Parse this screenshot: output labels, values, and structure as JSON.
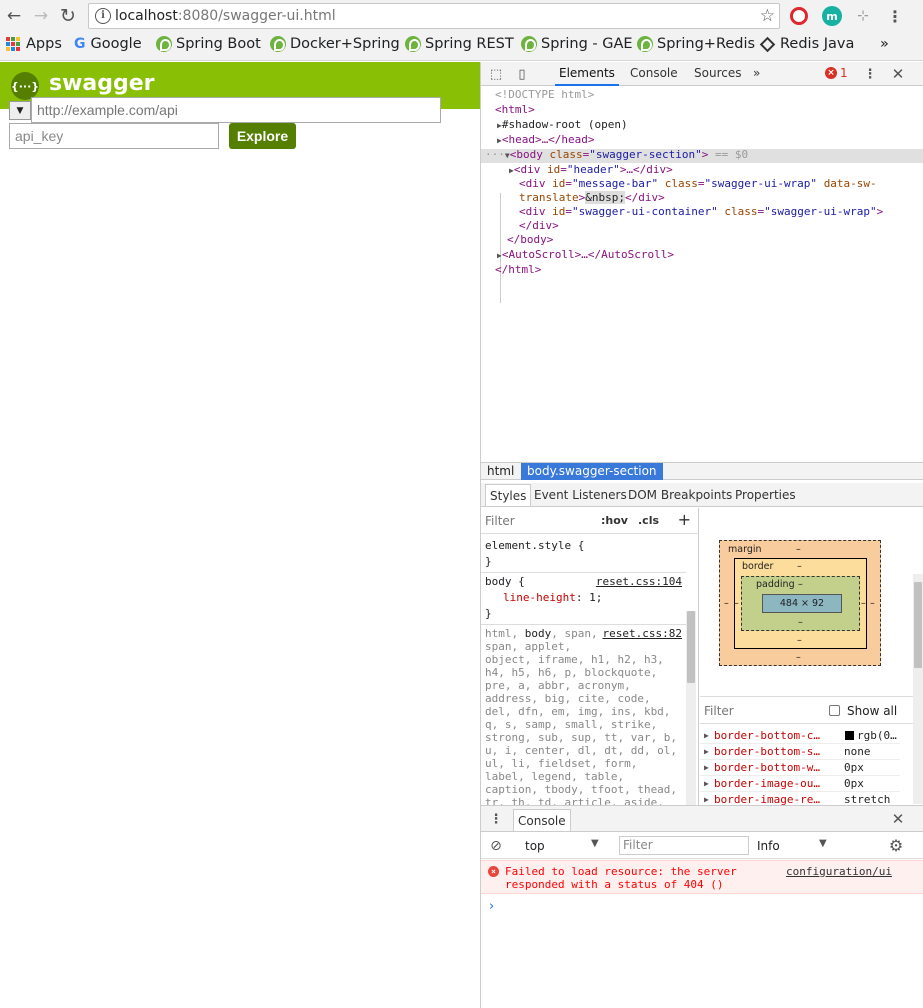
{
  "browser": {
    "url_host": "localhost",
    "url_rest": ":8080/swagger-ui.html",
    "bookmarks": [
      {
        "label": "Apps"
      },
      {
        "label": "Google"
      },
      {
        "label": "Spring Boot"
      },
      {
        "label": "Docker+Spring"
      },
      {
        "label": "Spring REST"
      },
      {
        "label": "Spring - GAE"
      },
      {
        "label": "Spring+Redis"
      },
      {
        "label": "Redis Java"
      }
    ],
    "more_bookmarks": "»",
    "ext_m": "m"
  },
  "swagger": {
    "logo": "{···}",
    "title": "swagger",
    "select_arrow": "▼",
    "url_placeholder": "http://example.com/api",
    "api_key_placeholder": "api_key",
    "explore_label": "Explore",
    "colors": {
      "header": "#89bf04",
      "button": "#547f00"
    }
  },
  "devtools": {
    "tabs": [
      "Elements",
      "Console",
      "Sources"
    ],
    "more": "»",
    "error_count": "1",
    "dom": {
      "doctype": "<!DOCTYPE html>",
      "html_open": "<html>",
      "shadow_root": "#shadow-root (open)",
      "head": "<head>…</head>",
      "body_tag": "body",
      "body_class_attr": "class",
      "body_class_val": "\"swagger-section\"",
      "body_eq": "== $0",
      "div": "div",
      "id_attr": "id",
      "class_attr": "class",
      "header_id": "\"header\"",
      "header_rest": ">…</div>",
      "msgbar_id": "\"message-bar\"",
      "msgbar_class": "\"swagger-ui-wrap\"",
      "translate_attr1": "data-sw-",
      "translate_attr2": "translate",
      "nbsp": "&nbsp;",
      "div_close": "</div>",
      "container_id": "\"swagger-ui-container\"",
      "container_class": "\"swagger-ui-wrap\"",
      "body_close": "</body>",
      "autoscroll": "<AutoScroll>…</AutoScroll>",
      "html_close": "</html>"
    },
    "breadcrumbs": [
      "html",
      "body.swagger-section"
    ],
    "sub_tabs": [
      "Styles",
      "Event Listeners",
      "DOM Breakpoints",
      "Properties"
    ],
    "styles": {
      "filter": "Filter",
      "hov": ":hov",
      "cls": ".cls",
      "plus": "+",
      "element_style": "element.style {",
      "close_brace": "}",
      "body_selector": "body {",
      "body_source": "reset.css:104",
      "line_height_prop": "line-height",
      "line_height_val": ": 1;",
      "reset_source": "reset.css:82",
      "reset_selector_lines": [
        "span, applet,",
        "object, iframe, h1, h2, h3,",
        "h4, h5, h6, p, blockquote,",
        "pre, a, abbr, acronym,",
        "address, big, cite, code,",
        "del, dfn, em, img, ins, kbd,",
        "q, s, samp, small, strike,",
        "strong, sub, sup, tt, var, b,",
        "u, i, center, dl, dt, dd, ol,",
        "ul, li, fieldset, form,",
        "label, legend, table,",
        "caption, tbody, tfoot, thead,",
        "tr, th, td, article, aside,"
      ],
      "reset_first_a": "html, ",
      "reset_first_b": "body",
      "reset_first_c": ", span,"
    },
    "box_model": {
      "margin": "margin",
      "border": "border",
      "padding": "padding",
      "dash": "–",
      "content": "484 × 92"
    },
    "computed": {
      "filter": "Filter",
      "show_all": "Show all",
      "rows": [
        {
          "name": "border-bottom-c…",
          "value": "rgb(0…"
        },
        {
          "name": "border-bottom-s…",
          "value": "none"
        },
        {
          "name": "border-bottom-w…",
          "value": "0px"
        },
        {
          "name": "border-image-ou…",
          "value": "0px"
        },
        {
          "name": "border-image-re…",
          "value": "stretch"
        }
      ]
    },
    "drawer": {
      "tab": "Console",
      "context": "top",
      "filter_placeholder": "Filter",
      "level": "Info",
      "error_line1": "Failed to load resource: the server",
      "error_line2": "responded with a status of 404 ()",
      "error_source": "configuration/ui",
      "prompt": "›"
    }
  }
}
